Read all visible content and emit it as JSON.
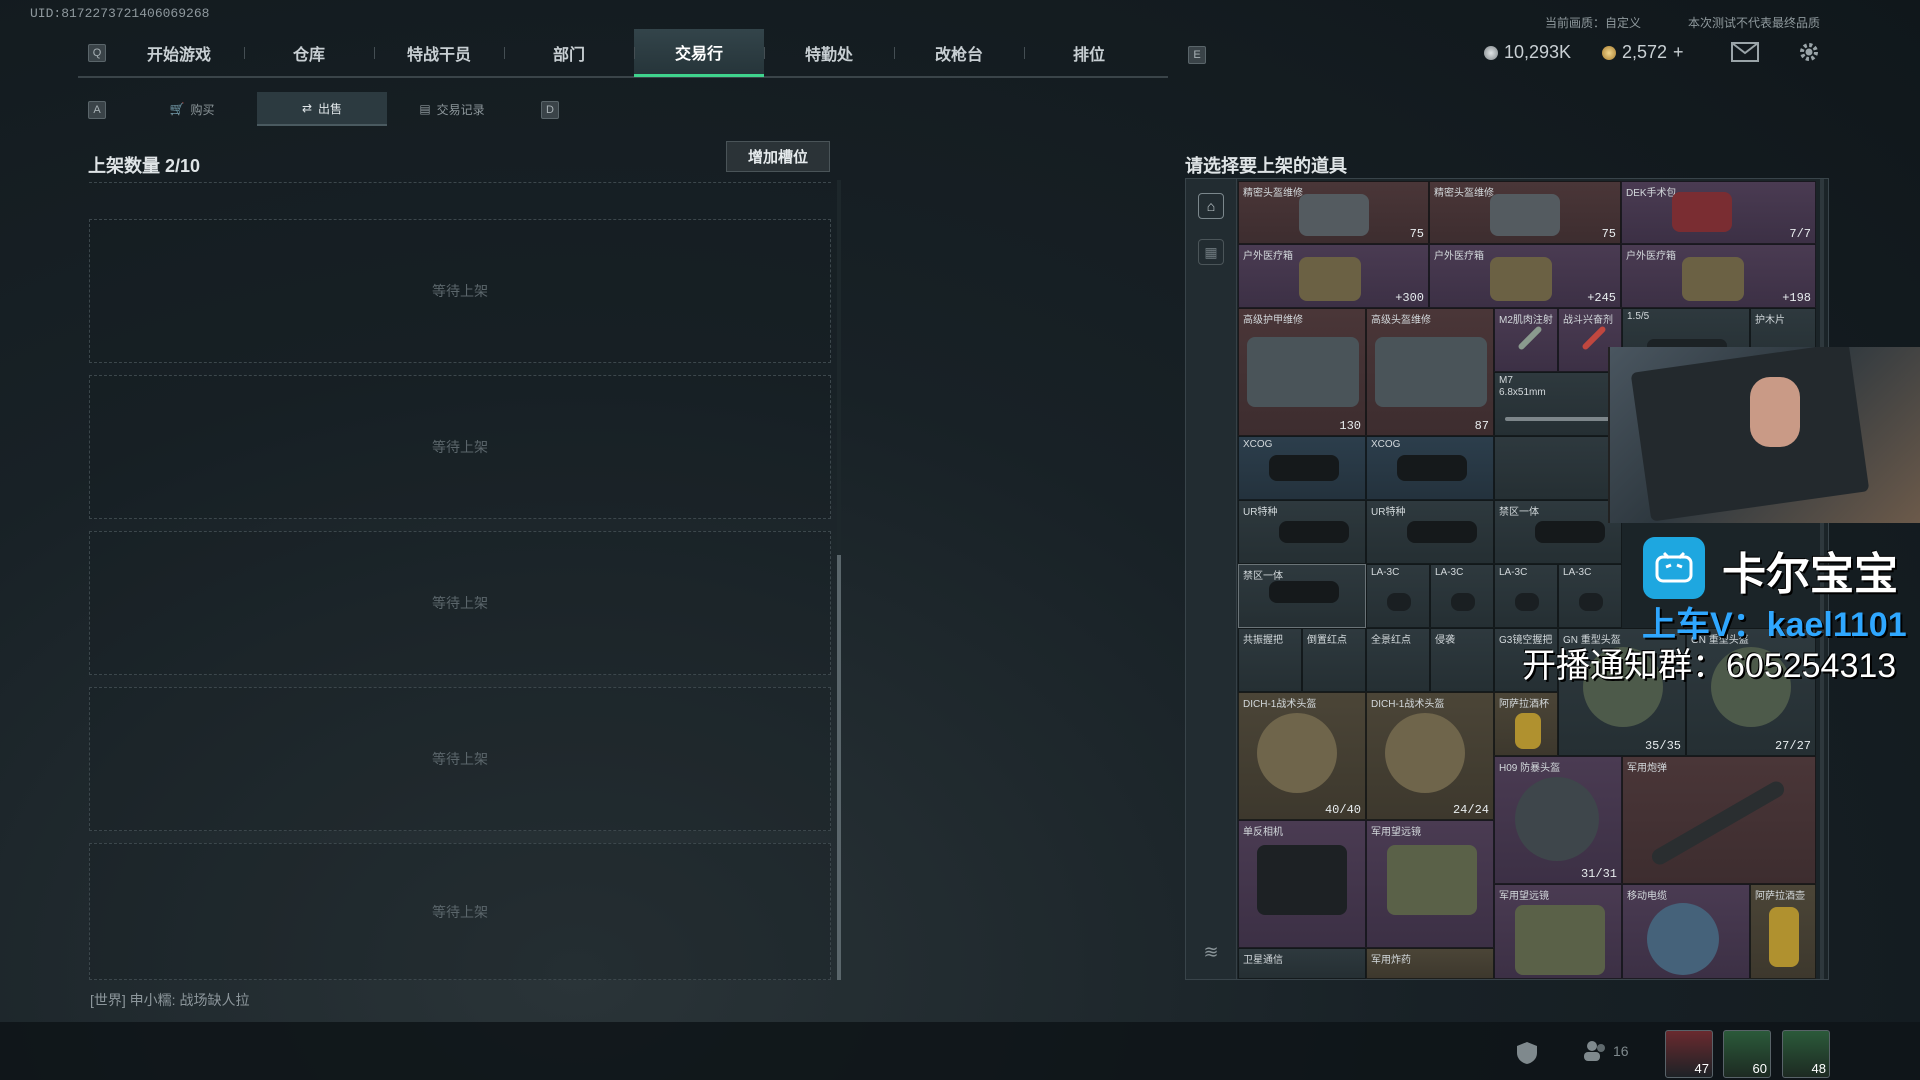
{
  "uid": "UID:8172273721406069268",
  "hud": {
    "quality_note": "当前画质：自定义",
    "test_note": "本次测试不代表最终品质"
  },
  "keys": {
    "left": "Q",
    "right": "E",
    "sub_left": "A",
    "sub_right": "D"
  },
  "nav": {
    "tabs": [
      "开始游戏",
      "仓库",
      "特战干员",
      "部门",
      "交易行",
      "特勤处",
      "改枪台",
      "排位"
    ],
    "active": "交易行"
  },
  "currency": {
    "silver": "10,293K",
    "gold": "2,572",
    "gold_plus": "+"
  },
  "subtabs": [
    {
      "label": "购买",
      "icon": "cart-icon"
    },
    {
      "label": "出售",
      "icon": "sell-icon"
    },
    {
      "label": "交易记录",
      "icon": "record-icon"
    }
  ],
  "subtab_active": "出售",
  "listing": {
    "title": "上架数量 2/10",
    "add_slot": "增加槽位",
    "slots": [
      "等待上架",
      "等待上架",
      "等待上架",
      "等待上架",
      "等待上架"
    ]
  },
  "chat": {
    "text": "[世界] 申小糯: 战场缺人拉"
  },
  "inventory": {
    "title": "请选择要上架的道具",
    "items": [
      {
        "name": "精密头盔维修",
        "count": "75"
      },
      {
        "name": "精密头盔维修",
        "count": "75"
      },
      {
        "name": "DEK手术包",
        "count": "7/7"
      },
      {
        "name": "户外医疗箱",
        "count": "+300"
      },
      {
        "name": "户外医疗箱",
        "count": "+245"
      },
      {
        "name": "户外医疗箱",
        "count": "+198"
      },
      {
        "name": "高级护甲维修",
        "count": "130"
      },
      {
        "name": "高级头盔维修",
        "count": "87"
      },
      {
        "name": "M2肌肉注射",
        "count": ""
      },
      {
        "name": "战斗兴奋剂",
        "count": ""
      },
      {
        "name": "1.5/5",
        "count": ""
      },
      {
        "name": "护木片",
        "count": ""
      },
      {
        "name": "M7",
        "count": "6.8x51mm"
      },
      {
        "name": "XCOG",
        "count": ""
      },
      {
        "name": "XCOG",
        "count": ""
      },
      {
        "name": "UR特种",
        "count": ""
      },
      {
        "name": "UR特种",
        "count": ""
      },
      {
        "name": "禁区一体",
        "count": ""
      },
      {
        "name": "禁区一体",
        "count": ""
      },
      {
        "name": "LA-3C",
        "count": ""
      },
      {
        "name": "LA-3C",
        "count": ""
      },
      {
        "name": "LA-3C",
        "count": ""
      },
      {
        "name": "LA-3C",
        "count": ""
      },
      {
        "name": "共振握把",
        "count": ""
      },
      {
        "name": "倒置红点",
        "count": ""
      },
      {
        "name": "全景红点",
        "count": ""
      },
      {
        "name": "侵袭",
        "count": ""
      },
      {
        "name": "G3镜空握把",
        "count": ""
      },
      {
        "name": "GN 重型头盔",
        "count": "35/35"
      },
      {
        "name": "GN 重型头盔",
        "count": "27/27"
      },
      {
        "name": "DICH-1战术头盔",
        "count": "40/40"
      },
      {
        "name": "DICH-1战术头盔",
        "count": "24/24"
      },
      {
        "name": "阿萨拉酒杯",
        "count": ""
      },
      {
        "name": "H09 防暴头盔",
        "count": "31/31"
      },
      {
        "name": "军用炮弹",
        "count": ""
      },
      {
        "name": "单反相机",
        "count": ""
      },
      {
        "name": "军用望远镜",
        "count": ""
      },
      {
        "name": "军用望远镜",
        "count": ""
      },
      {
        "name": "移动电缆",
        "count": ""
      },
      {
        "name": "阿萨拉酒壶",
        "count": ""
      },
      {
        "name": "卫星通信",
        "count": ""
      },
      {
        "name": "军用炸药",
        "count": ""
      }
    ]
  },
  "stream_overlay": {
    "name": "卡尔宝宝",
    "wechat": "上车V：kael1101",
    "group": "开播通知群：605254313"
  },
  "bottom": {
    "friends": "16",
    "avatars": [
      "47",
      "60",
      "48"
    ]
  },
  "colors": {
    "accent": "#3fd38d",
    "stream_blue": "#2fa7ff"
  }
}
